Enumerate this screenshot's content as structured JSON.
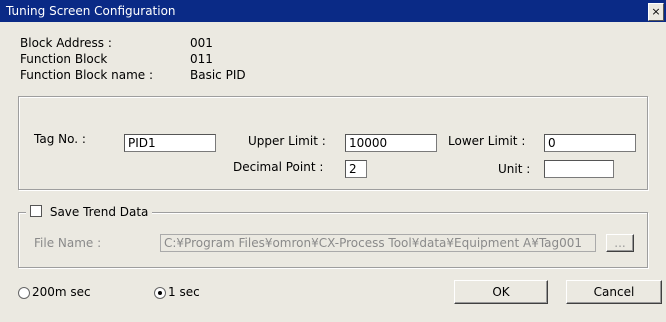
{
  "window": {
    "title": "Tuning Screen Configuration",
    "close_label": "×"
  },
  "info": {
    "block_address_label": "Block Address :",
    "block_address_value": "001",
    "function_block_label": "Function Block",
    "function_block_value": "011",
    "function_block_name_label": "Function Block name :",
    "function_block_name_value": "Basic PID"
  },
  "tag": {
    "tag_no_label": "Tag No. :",
    "tag_no_value": "PID1",
    "upper_limit_label": "Upper Limit :",
    "upper_limit_value": "10000",
    "lower_limit_label": "Lower Limit :",
    "lower_limit_value": "0",
    "decimal_point_label": "Decimal Point :",
    "decimal_point_value": "2",
    "unit_label": "Unit :",
    "unit_value": ""
  },
  "trend": {
    "save_trend_label": "Save Trend Data",
    "save_trend_checked": false,
    "file_name_label": "File Name :",
    "file_name_value": "C:¥Program Files¥omron¥CX-Process Tool¥data¥Equipment A¥Tag001",
    "browse_label": "..."
  },
  "interval": {
    "opt1_label": "200m sec",
    "opt1_selected": false,
    "opt2_label": "1 sec",
    "opt2_selected": true
  },
  "buttons": {
    "ok_label": "OK",
    "cancel_label": "Cancel"
  }
}
